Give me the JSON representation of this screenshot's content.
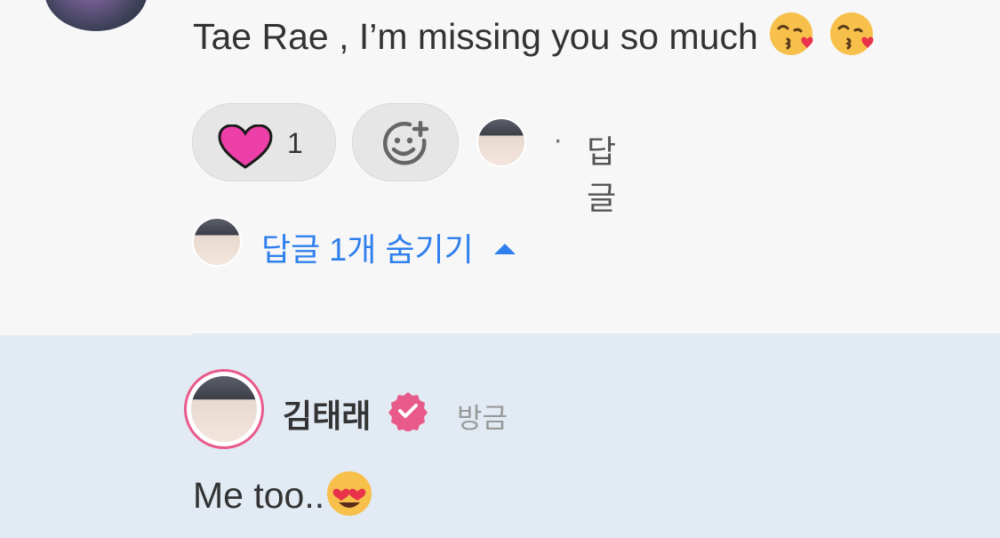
{
  "comment": {
    "text": "Tae Rae , I’m missing you so much",
    "emoji": [
      "face-blowing-kiss-emoji",
      "face-blowing-kiss-emoji"
    ]
  },
  "actions": {
    "like_count": "1",
    "separator": "·",
    "reply_label": "답글"
  },
  "replies_toggle": {
    "label": "답글 1개 숨기기"
  },
  "reply": {
    "author": "김태래",
    "time": "방금",
    "text": "Me too..",
    "emoji": "smiling-face-with-heart-eyes-emoji"
  },
  "colors": {
    "accent_blue": "#2f80ed",
    "heart_pink": "#ec3fa7",
    "verified_pink": "#e85a8a",
    "reply_bg": "#e2eaf4"
  }
}
